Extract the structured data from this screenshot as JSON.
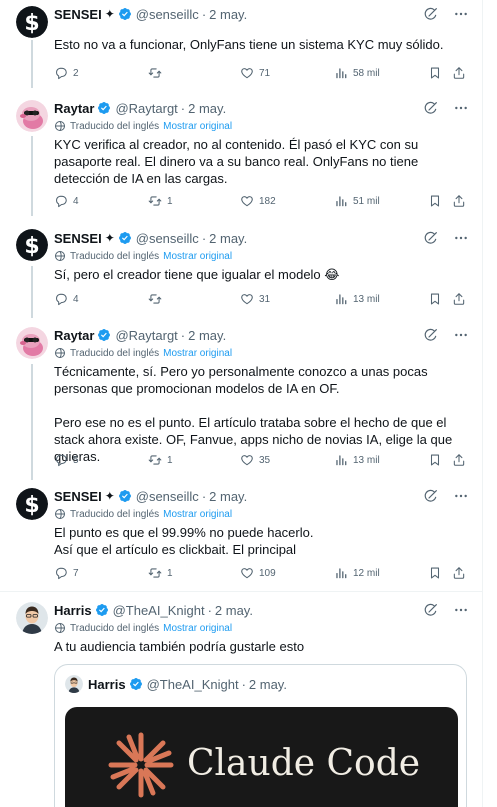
{
  "translation": {
    "label": "Traducido del inglés",
    "show_original": "Mostrar original"
  },
  "icons": {
    "grok": "grok-icon",
    "more": "more-dots-icon",
    "reply": "reply-icon",
    "retweet": "retweet-icon",
    "like": "heart-icon",
    "views": "views-icon",
    "bookmark": "bookmark-icon",
    "share": "share-icon",
    "translate": "translate-icon"
  },
  "colors": {
    "accent": "#1d9bf0",
    "muted": "#536471",
    "verified": "#1d9bf0"
  },
  "tweets": [
    {
      "name": "SENSEI",
      "badge": "✦",
      "handle": "@senseillc",
      "dot": "·",
      "date": "2 may.",
      "translated": false,
      "text": "Esto no va a funcionar, OnlyFans tiene un sistema KYC muy sólido.",
      "replies": "2",
      "retweets": "",
      "likes": "71",
      "views": "58 mil"
    },
    {
      "name": "Raytar",
      "handle": "@Raytargt",
      "dot": "·",
      "date": "2 may.",
      "translated": true,
      "text": "KYC verifica al creador, no al contenido. Él pasó el KYC con su pasaporte real. El dinero va a su banco real. OnlyFans no tiene detección de IA en las cargas.",
      "replies": "4",
      "retweets": "1",
      "likes": "182",
      "views": "51 mil"
    },
    {
      "name": "SENSEI",
      "badge": "✦",
      "handle": "@senseillc",
      "dot": "·",
      "date": "2 may.",
      "translated": true,
      "text": "Sí, pero el creador tiene que igualar el modelo 😂",
      "replies": "4",
      "retweets": "",
      "likes": "31",
      "views": "13 mil"
    },
    {
      "name": "Raytar",
      "handle": "@Raytargt",
      "dot": "·",
      "date": "2 may.",
      "translated": true,
      "text": "Técnicamente, sí. Pero yo personalmente conozco a unas pocas personas que promocionan modelos de IA en OF.\n\nPero ese no es el punto. El artículo trataba sobre el hecho de que el stack ahora existe. OF, Fanvue, apps nicho de novias IA, elige la que quieras.",
      "replies": "5",
      "retweets": "1",
      "likes": "35",
      "views": "13 mil"
    },
    {
      "name": "SENSEI",
      "badge": "✦",
      "handle": "@senseillc",
      "dot": "·",
      "date": "2 may.",
      "translated": true,
      "text": "El punto es que el 99.99% no puede hacerlo.\nAsí que el artículo es clickbait. El principal",
      "replies": "7",
      "retweets": "1",
      "likes": "109",
      "views": "12 mil"
    },
    {
      "name": "Harris",
      "handle": "@TheAI_Knight",
      "dot": "·",
      "date": "2 may.",
      "translated": true,
      "text": "A tu audiencia también podría gustarle esto"
    }
  ],
  "quote": {
    "name": "Harris",
    "handle": "@TheAI_Knight",
    "dot": "·",
    "date": "2 may.",
    "media_title": "Claude Code"
  }
}
